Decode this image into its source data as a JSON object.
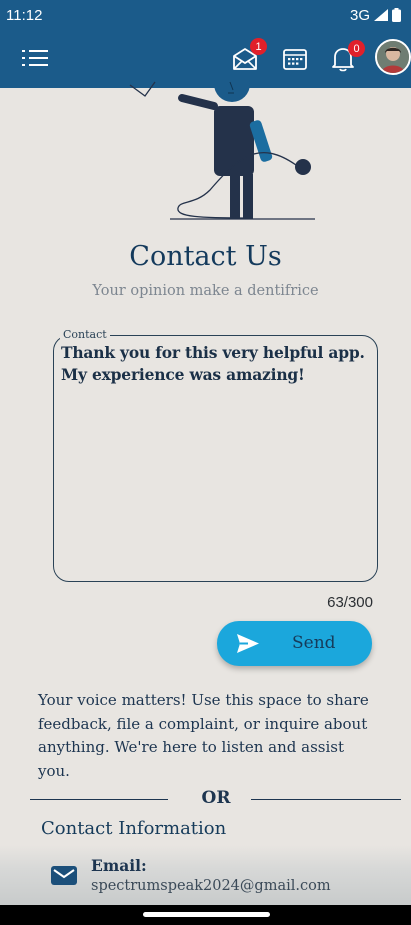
{
  "status_bar": {
    "time": "11:12",
    "network": "3G"
  },
  "app_bar": {
    "icons": [
      "menu-icon",
      "mail-icon",
      "calendar-icon",
      "bell-icon",
      "avatar"
    ],
    "mail_badge": "1",
    "bell_badge": "0"
  },
  "page": {
    "title": "Contact Us",
    "subtitle": "Your opinion make a dentifrice"
  },
  "contact_field": {
    "label": "Contact",
    "value": "Thank you for this very helpful app. My experience was amazing!",
    "counter": "63/300"
  },
  "send_button": {
    "label": "Send"
  },
  "info_text": "Your voice matters! Use this space to share feedback, file a complaint, or inquire about anything. We're here to listen and assist you.",
  "divider": {
    "label": "OR"
  },
  "contact_info": {
    "title": "Contact Information",
    "email_label": "Email:",
    "email_value": "spectrumspeak2024@gmail.com"
  },
  "colors": {
    "app_bar": "#1b5b8a",
    "background": "#e8e5e1",
    "send_button": "#1ba7dc",
    "badge": "#e0202a",
    "title": "#143a5c"
  }
}
